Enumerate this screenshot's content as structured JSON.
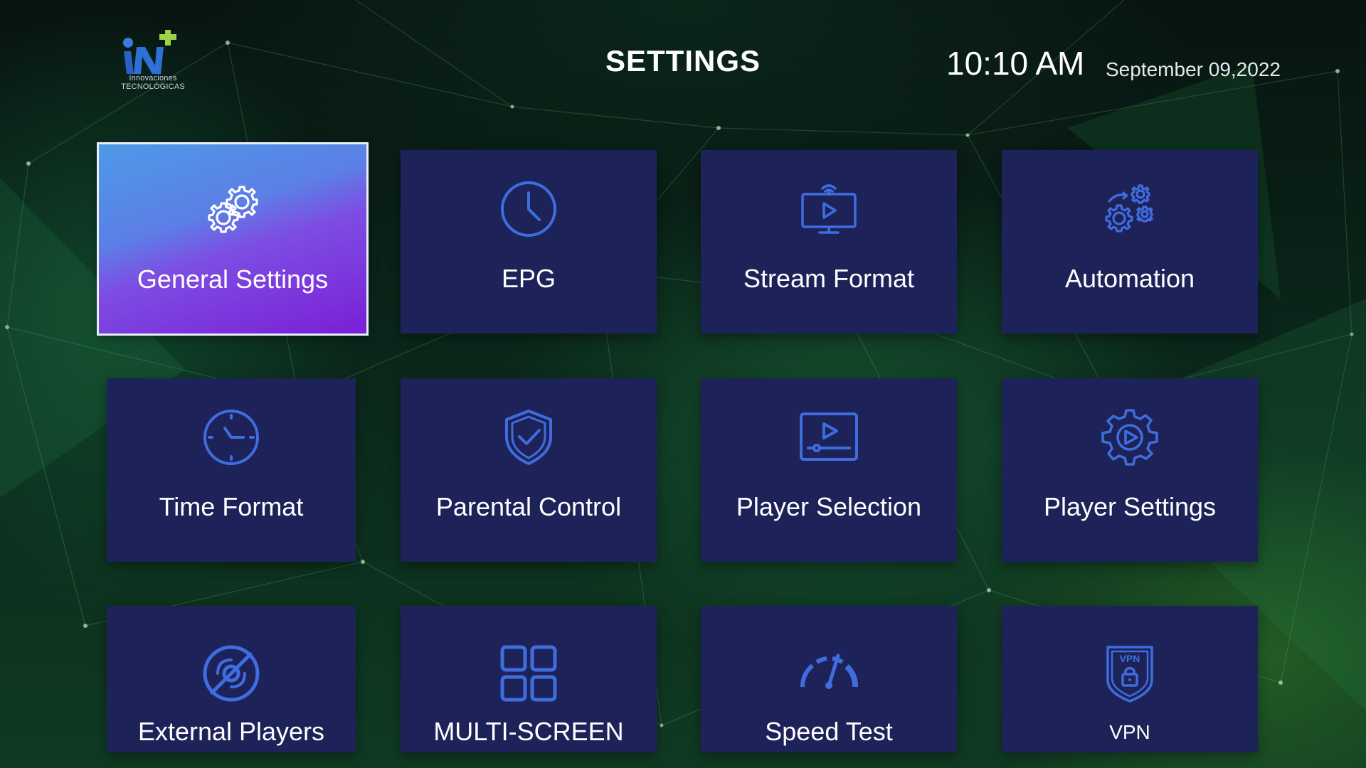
{
  "header": {
    "logo_text": "Innovaciones\nTECNOLÓGICAS",
    "title": "SETTINGS",
    "time": "10:10 AM",
    "date": "September 09,2022"
  },
  "colors": {
    "tile_bg": "#1d2358",
    "icon_blue": "#3f6de0",
    "selected_gradient_start": "#4d9ae8",
    "selected_gradient_end": "#7a1fd6"
  },
  "tiles": [
    {
      "label": "General Settings",
      "icon": "gears-icon",
      "selected": true
    },
    {
      "label": "EPG",
      "icon": "clock-icon"
    },
    {
      "label": "Stream Format",
      "icon": "stream-screen-icon"
    },
    {
      "label": "Automation",
      "icon": "automation-gears-icon"
    },
    {
      "label": "Time Format",
      "icon": "time-clock-icon"
    },
    {
      "label": "Parental Control",
      "icon": "shield-check-icon"
    },
    {
      "label": "Player Selection",
      "icon": "player-screen-icon"
    },
    {
      "label": "Player Settings",
      "icon": "gear-play-icon"
    },
    {
      "label": "External Players",
      "icon": "disc-slash-icon"
    },
    {
      "label": "MULTI-SCREEN",
      "icon": "grid-squares-icon"
    },
    {
      "label": "Speed Test",
      "icon": "speedometer-icon"
    },
    {
      "label": "VPN",
      "icon": "vpn-lock-icon"
    }
  ]
}
